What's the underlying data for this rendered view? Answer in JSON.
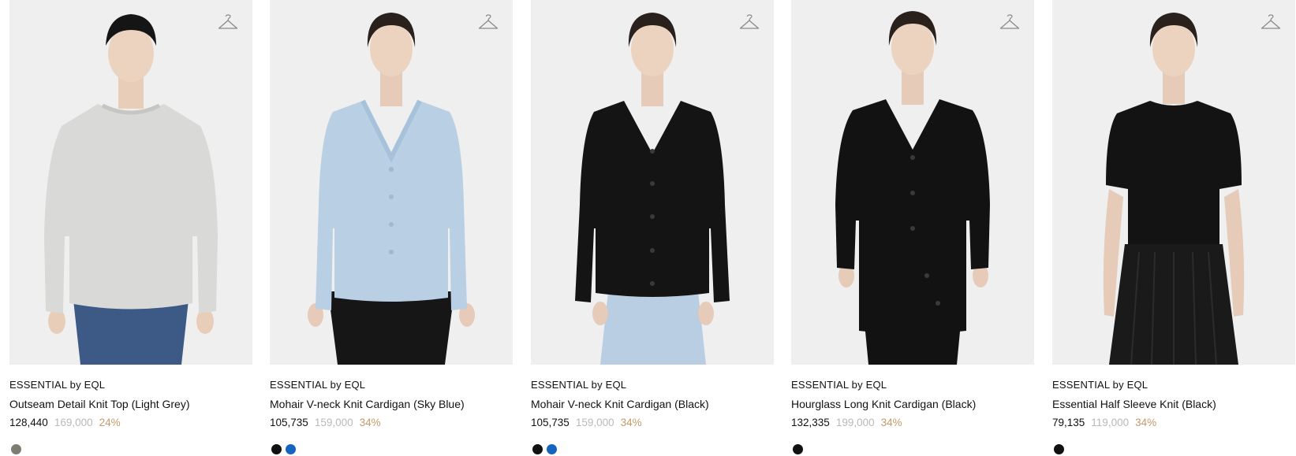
{
  "products": [
    {
      "brand": "ESSENTIAL by EQL",
      "title": "Outseam Detail Knit Top (Light Grey)",
      "price": "128,440",
      "original_price": "169,000",
      "discount": "24%",
      "swatches": [
        "#7d7d74"
      ],
      "garment_color": "#d9d9d7",
      "bottom_color": "#3d5a86",
      "model": "male"
    },
    {
      "brand": "ESSENTIAL by EQL",
      "title": "Mohair V-neck Knit Cardigan (Sky Blue)",
      "price": "105,735",
      "original_price": "159,000",
      "discount": "34%",
      "swatches": [
        "#111111",
        "#1565c0"
      ],
      "garment_color": "#b8cfe4",
      "bottom_color": "#161616",
      "model": "female"
    },
    {
      "brand": "ESSENTIAL by EQL",
      "title": "Mohair V-neck Knit Cardigan (Black)",
      "price": "105,735",
      "original_price": "159,000",
      "discount": "34%",
      "swatches": [
        "#111111",
        "#1565c0"
      ],
      "garment_color": "#141414",
      "bottom_color": "#b9cde3",
      "model": "female"
    },
    {
      "brand": "ESSENTIAL by EQL",
      "title": "Hourglass Long Knit Cardigan (Black)",
      "price": "132,335",
      "original_price": "199,000",
      "discount": "34%",
      "swatches": [
        "#111111"
      ],
      "garment_color": "#121212",
      "bottom_color": "#121212",
      "model": "female"
    },
    {
      "brand": "ESSENTIAL by EQL",
      "title": "Essential Half Sleeve Knit (Black)",
      "price": "79,135",
      "original_price": "119,000",
      "discount": "34%",
      "swatches": [
        "#111111"
      ],
      "garment_color": "#131313",
      "bottom_color": "#1a1a1a",
      "model": "female"
    }
  ],
  "icons": {
    "wishlist": "hanger-icon"
  },
  "colors": {
    "image_bg": "#efefef",
    "discount": "#c59a6b",
    "original_price": "#b9b9b9"
  }
}
